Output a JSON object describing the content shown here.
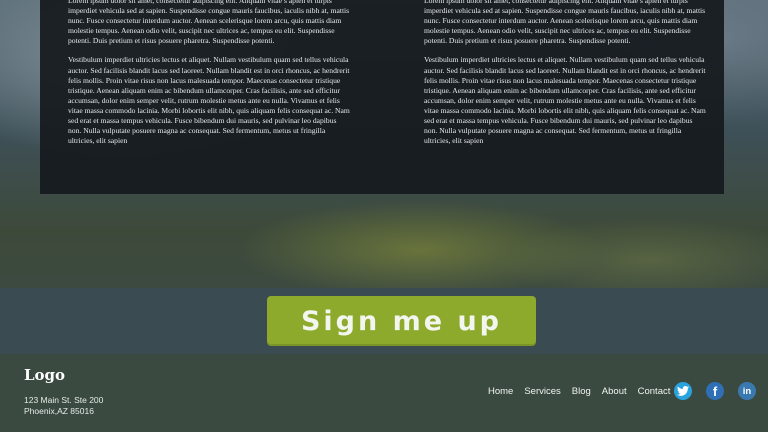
{
  "content": {
    "left_column": [
      "Lorem ipsum dolor sit amet, consectetur adipiscing elit. Aliquam vitae s apien et turpis imperdiet vehicula sed at sapien. Suspendisse congue mauris faucibus, iaculis nibh at, mattis nunc. Fusce consectetur interdum auctor. Aenean scelerisque lorem arcu, quis mattis diam molestie tempus. Aenean odio velit, suscipit nec ultrices ac, tempus eu elit. Suspendisse potenti. Duis pretium et risus posuere pharetra. Suspendisse potenti.",
      "Vestibulum imperdiet ultricies lectus et aliquet. Nullam vestibulum quam sed tellus vehicula auctor. Sed facilisis blandit lacus sed laoreet. Nullam blandit est in orci rhoncus, ac hendrerit felis mollis. Proin vitae risus non lacus malesuada tempor. Maecenas consectetur tristique tristique. Aenean aliquam enim ac bibendum ullamcorper. Cras facilisis, ante sed efficitur accumsan, dolor enim semper velit, rutrum molestie metus ante eu nulla. Vivamus et felis vitae massa commodo lacinia. Morbi lobortis elit nibh, quis aliquam felis consequat ac. Nam sed erat et massa tempus vehicula. Fusce bibendum dui mauris, sed pulvinar leo dapibus non. Nulla vulputate posuere magna ac consequat. Sed fermentum, metus ut fringilla ultricies, elit sapien"
    ],
    "right_column": [
      "Lorem ipsum dolor sit amet, consectetur adipiscing elit. Aliquam vitae s apien et turpis imperdiet vehicula sed at sapien. Suspendisse congue mauris faucibus, iaculis nibh at, mattis nunc. Fusce consectetur interdum auctor. Aenean scelerisque lorem arcu, quis mattis diam molestie tempus. Aenean odio velit, suscipit nec ultrices ac, tempus eu elit. Suspendisse potenti. Duis pretium et risus posuere pharetra. Suspendisse potenti.",
      "Vestibulum imperdiet ultricies lectus et aliquet. Nullam vestibulum quam sed tellus vehicula auctor. Sed facilisis blandit lacus sed laoreet. Nullam blandit est in orci rhoncus, ac hendrerit felis mollis. Proin vitae risus non lacus malesuada tempor. Maecenas consectetur tristique tristique. Aenean aliquam enim ac bibendum ullamcorper. Cras facilisis, ante sed efficitur accumsan, dolor enim semper velit, rutrum molestie metus ante eu nulla. Vivamus et felis vitae massa commodo lacinia. Morbi lobortis elit nibh, quis aliquam felis consequat ac. Nam sed erat et massa tempus vehicula. Fusce bibendum dui mauris, sed pulvinar leo dapibus non. Nulla vulputate posuere magna ac consequat. Sed fermentum, metus ut fringilla ultricies, elit sapien"
    ]
  },
  "signup": {
    "label": "Sign me up",
    "color": "#8daa2d"
  },
  "footer": {
    "logo": "Logo",
    "address_line1": "123 Main St. Ste 200",
    "address_line2": "Phoenix,AZ 85016",
    "nav": [
      "Home",
      "Services",
      "Blog",
      "About",
      "Contact"
    ],
    "social": [
      {
        "icon": "twitter-icon",
        "glyph": "t",
        "color": "#29a3e0"
      },
      {
        "icon": "facebook-icon",
        "glyph": "f",
        "color": "#2f6fb6"
      },
      {
        "icon": "linkedin-icon",
        "glyph": "in",
        "color": "#3a78b0"
      }
    ]
  }
}
